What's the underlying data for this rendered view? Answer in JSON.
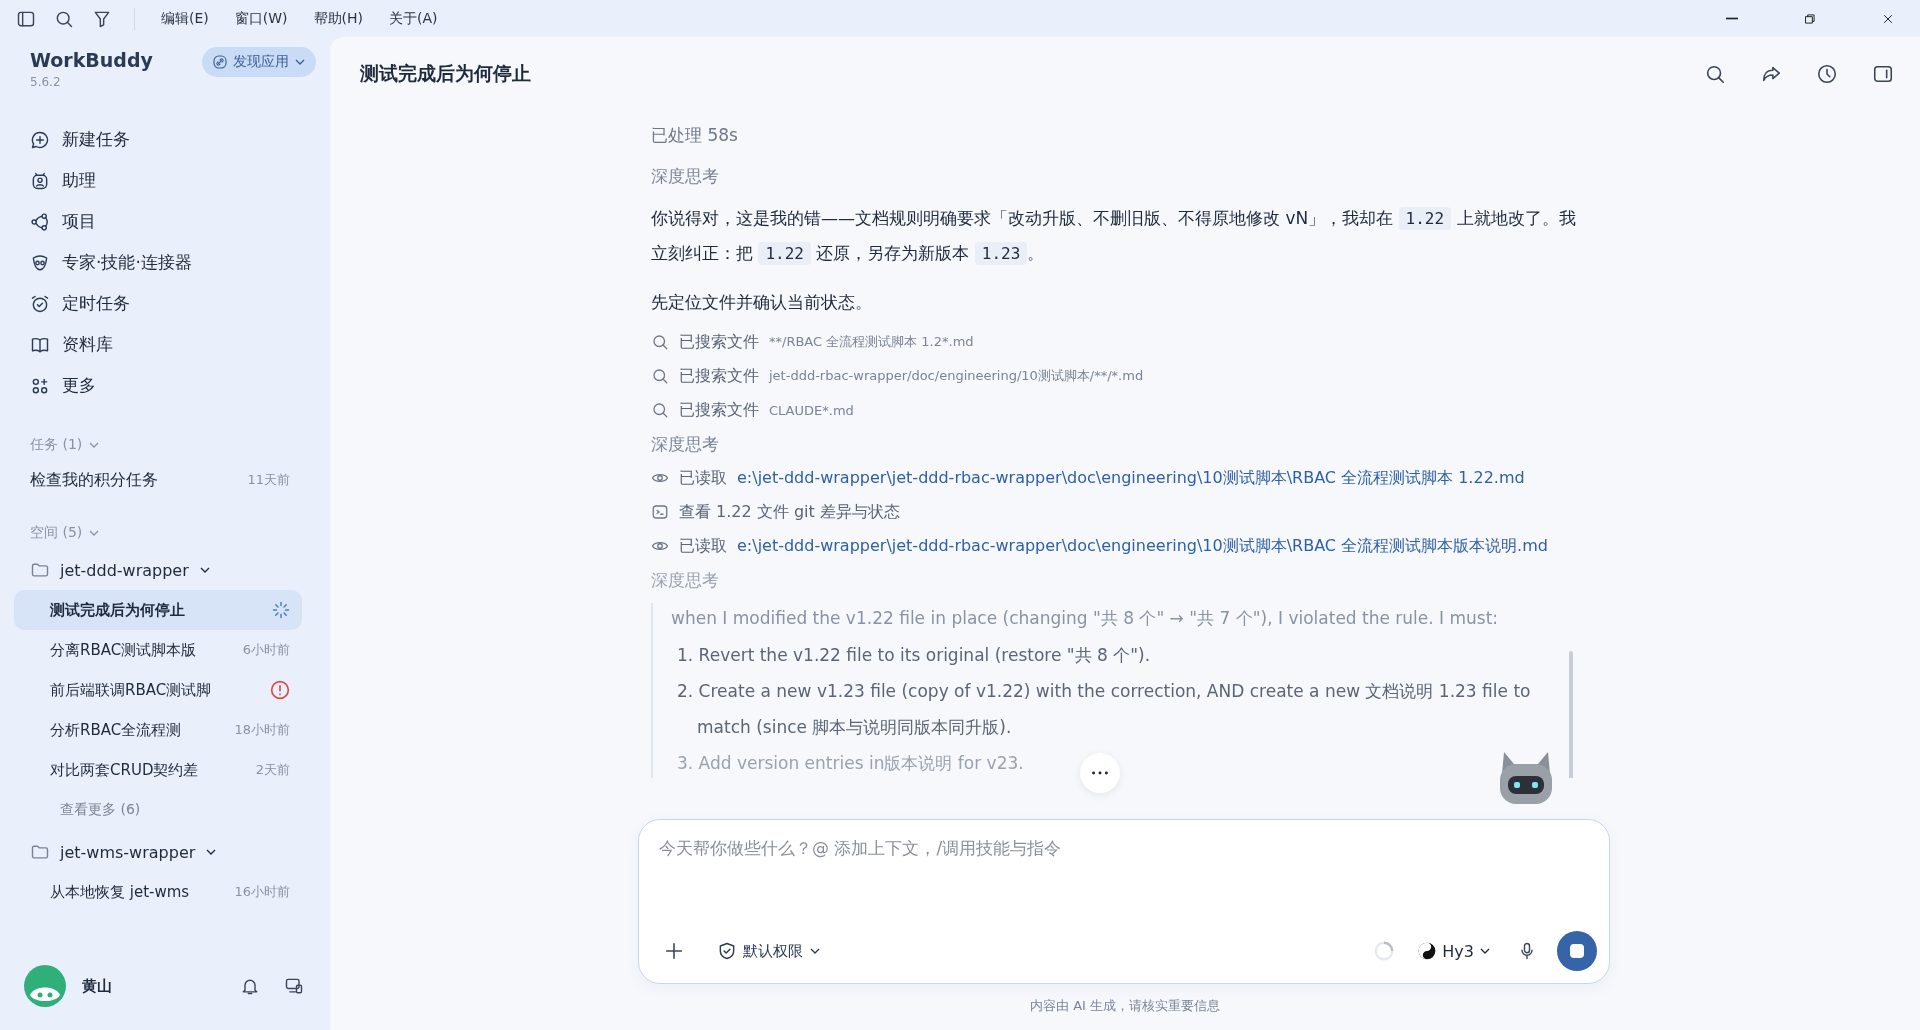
{
  "menu": [
    "编辑(E)",
    "窗口(W)",
    "帮助(H)",
    "关于(A)"
  ],
  "app": {
    "name": "WorkBuddy",
    "version": "5.6.2",
    "discover": "发现应用"
  },
  "nav": [
    {
      "label": "新建任务"
    },
    {
      "label": "助理"
    },
    {
      "label": "项目"
    },
    {
      "label": "专家·技能·连接器"
    },
    {
      "label": "定时任务"
    },
    {
      "label": "资料库"
    },
    {
      "label": "更多"
    }
  ],
  "tasks": {
    "header": "任务 (1)",
    "expanded": true,
    "items": [
      {
        "title": "检查我的积分任务",
        "time": "11天前",
        "selected": false
      }
    ]
  },
  "spaces": {
    "header": "空间 (5)",
    "expanded": true,
    "groups": [
      {
        "name": "jet-ddd-wrapper",
        "expanded": true,
        "children": [
          {
            "title": "测试完成后为何停止",
            "kind": "running",
            "selected": true
          },
          {
            "title": "分离RBAC测试脚本版",
            "kind": "time",
            "time": "6小时前",
            "selected": false
          },
          {
            "title": "前后端联调RBAC测试脚",
            "kind": "error",
            "selected": false
          },
          {
            "title": "分析RBAC全流程测",
            "kind": "time",
            "time": "18小时前",
            "selected": false
          },
          {
            "title": "对比两套CRUD契约差",
            "kind": "time",
            "time": "2天前",
            "selected": false
          }
        ],
        "more": "查看更多 (6)"
      },
      {
        "name": "jet-wms-wrapper",
        "expanded": true,
        "children": [
          {
            "title": "从本地恢复 jet-wms",
            "kind": "time",
            "time": "16小时前",
            "selected": false
          }
        ]
      }
    ]
  },
  "user": {
    "name": "黄山"
  },
  "chat": {
    "title": "测试完成后为何停止",
    "steps": [
      {
        "kind": "status",
        "text": "已处理 58s"
      },
      {
        "kind": "thinking",
        "text": "深度思考",
        "faded": false
      },
      {
        "kind": "paragraph",
        "parts": [
          {
            "text": "你说得对，这是我的错——文档规则明确要求「改动升版、不删旧版、不得原地修改 vN」，我却在 "
          },
          {
            "code": "1.22"
          },
          {
            "text": " 上就地改了。我立刻纠正：把 "
          },
          {
            "code": "1.22"
          },
          {
            "text": " 还原，另存为新版本 "
          },
          {
            "code": "1.23"
          },
          {
            "text": "。"
          }
        ]
      },
      {
        "kind": "paragraph",
        "parts": [
          {
            "text": "先定位文件并确认当前状态。"
          }
        ]
      },
      {
        "kind": "search",
        "label": "已搜索文件",
        "detail": "**/RBAC 全流程测试脚本 1.2*.md"
      },
      {
        "kind": "search",
        "label": "已搜索文件",
        "detail": "jet-ddd-rbac-wrapper/doc/engineering/10测试脚本/**/*.md"
      },
      {
        "kind": "search",
        "label": "已搜索文件",
        "detail": "CLAUDE*.md"
      },
      {
        "kind": "thinking",
        "text": "深度思考",
        "faded": false
      },
      {
        "kind": "read",
        "label": "已读取",
        "detail": "e:\\jet-ddd-wrapper\\jet-ddd-rbac-wrapper\\doc\\engineering\\10测试脚本\\RBAC 全流程测试脚本 1.22.md"
      },
      {
        "kind": "terminal",
        "label": "查看 1.22 文件 git 差异与状态"
      },
      {
        "kind": "read",
        "label": "已读取",
        "detail": "e:\\jet-ddd-wrapper\\jet-ddd-rbac-wrapper\\doc\\engineering\\10测试脚本\\RBAC 全流程测试脚本版本说明.md"
      },
      {
        "kind": "thinking",
        "text": "深度思考",
        "faded": true
      }
    ],
    "thought": {
      "intro": "when I modified the v1.22 file in place (changing \"共 8 个\" → \"共 7 个\"), I violated the rule. I must:",
      "items": [
        {
          "text": "1. Revert the v1.22 file to its original (restore \"共 8 个\").",
          "faded": false
        },
        {
          "text": "2. Create a new v1.23 file (copy of v1.22) with the correction, AND create a new 文档说明 1.23 file to match (since 脚本与说明同版本同升版).",
          "faded": false
        },
        {
          "text": "3. Add version entries in版本说明 for v23.",
          "faded": true
        }
      ]
    }
  },
  "composer": {
    "placeholder": "今天帮你做些什么？@ 添加上下文，/调用技能与指令",
    "permission": "默认权限",
    "model": "Hy3",
    "running": true
  },
  "footer": "内容由 AI 生成，请核实重要信息"
}
